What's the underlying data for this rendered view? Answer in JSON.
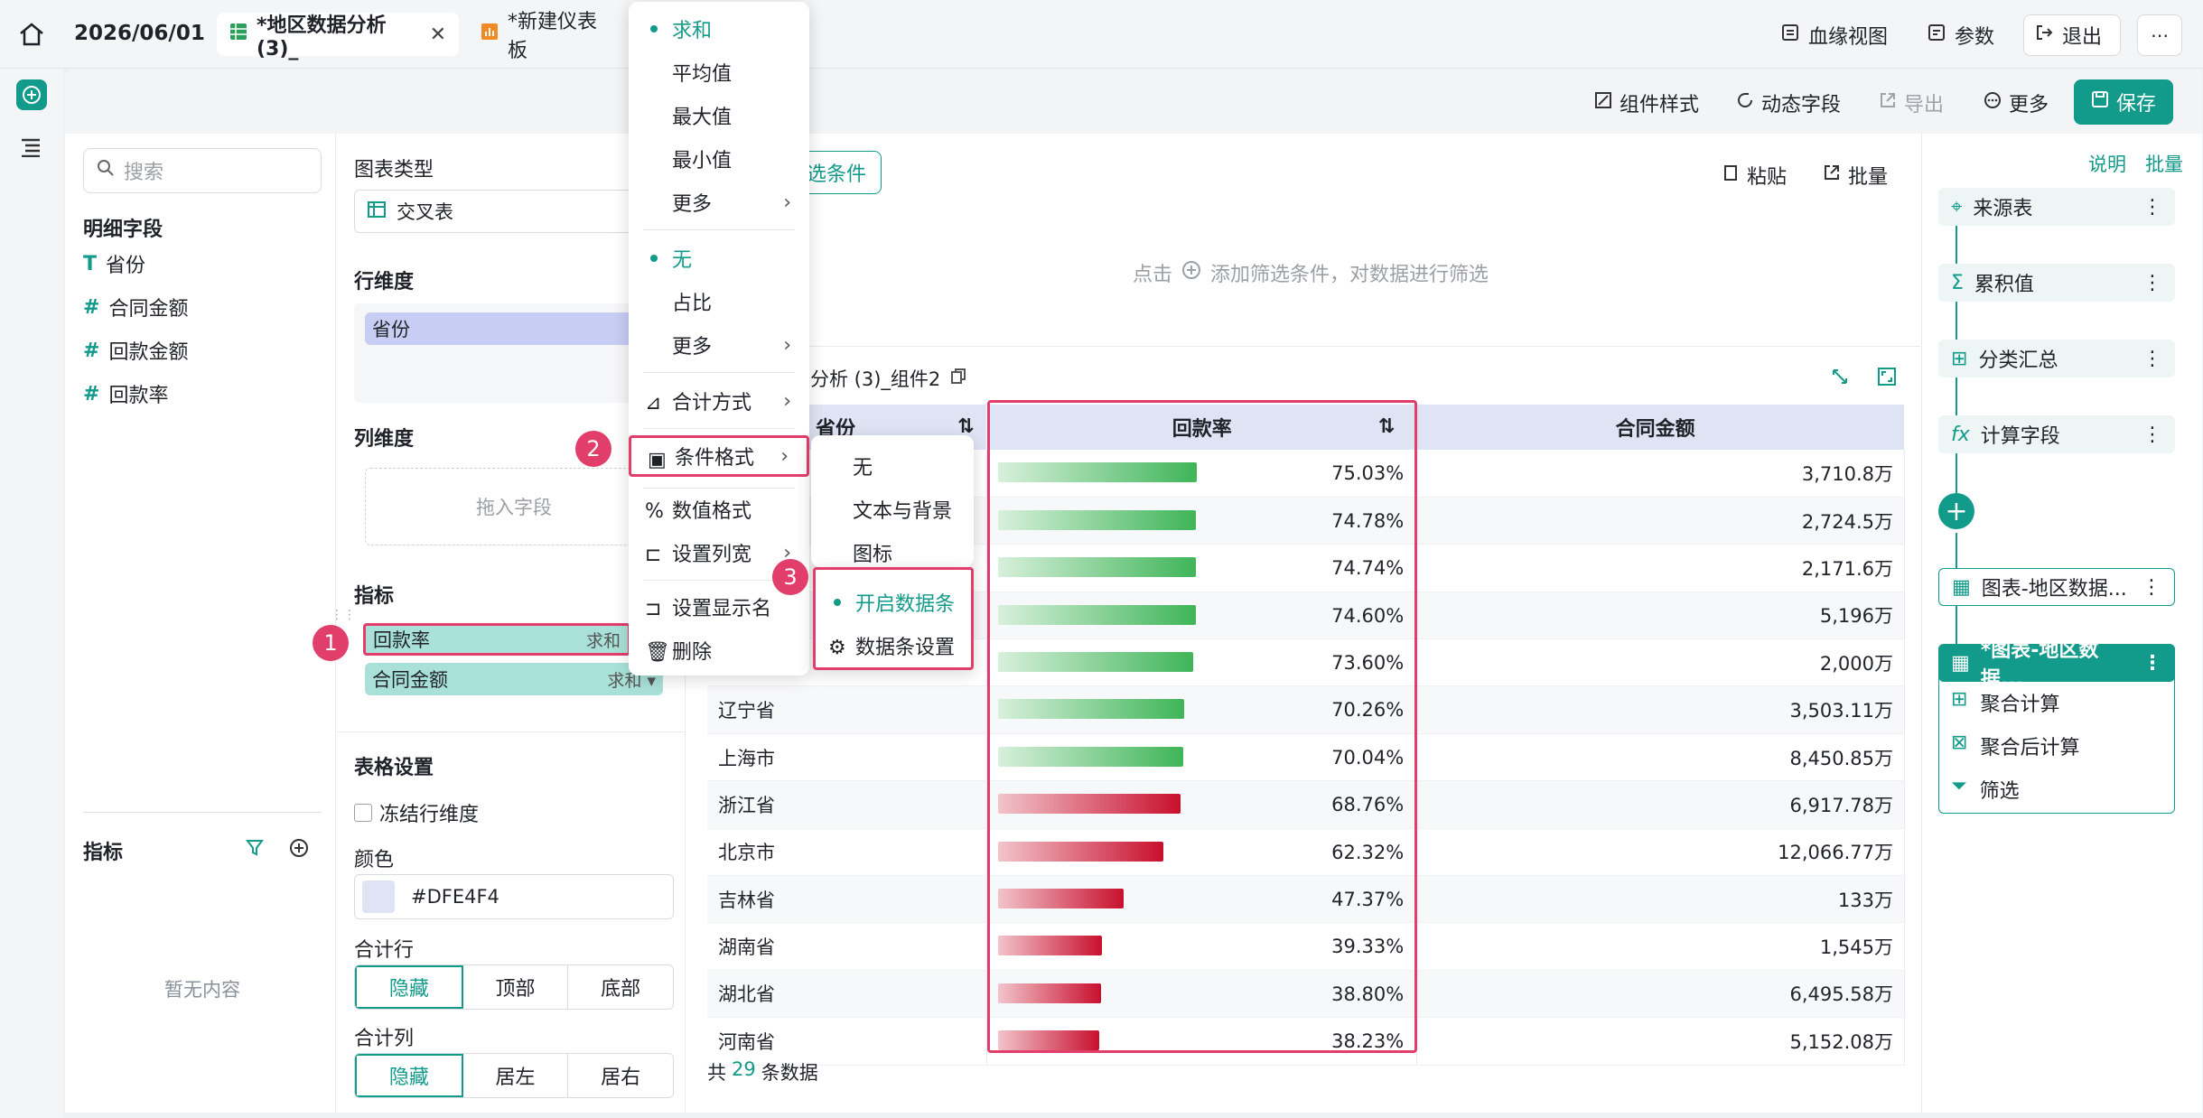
{
  "topbar": {
    "date": "2026/06/01",
    "tabs": [
      {
        "label": "*地区数据分析 (3)_",
        "active": true
      },
      {
        "label": "*新建仪表板",
        "active": false
      }
    ],
    "lineage_label": "血缘视图",
    "params_label": "参数",
    "exit_label": "退出"
  },
  "toolbar": {
    "component_style": "组件样式",
    "dynamic_field": "动态字段",
    "export": "导出",
    "more": "更多",
    "save": "保存"
  },
  "field_panel": {
    "search_placeholder": "搜索",
    "detail_fields_title": "明细字段",
    "fields": [
      "省份",
      "合同金额",
      "回款金额",
      "回款率"
    ],
    "metrics_title": "指标",
    "empty_text": "暂无内容"
  },
  "config": {
    "chart_type_label": "图表类型",
    "chart_type_value": "交叉表",
    "row_dim_label": "行维度",
    "row_dim_field": "省份",
    "col_dim_label": "列维度",
    "drag_hint": "拖入字段",
    "metrics_label": "指标",
    "metric_1": "回款率",
    "metric_1_agg": "求和",
    "metric_2": "合同金额",
    "metric_2_agg": "求和",
    "table_settings": "表格设置",
    "freeze_row_dim": "冻结行维度",
    "color_label": "颜色",
    "color_value": "#DFE4F4",
    "total_row_label": "合计行",
    "total_row_options": [
      "隐藏",
      "顶部",
      "底部"
    ],
    "total_col_label": "合计列",
    "total_col_options": [
      "隐藏",
      "居左",
      "居右"
    ]
  },
  "filter": {
    "add_condition": "选条件",
    "paste": "粘贴",
    "batch": "批量",
    "hint_prefix": "点击",
    "hint_text": "添加筛选条件，对数据进行筛选"
  },
  "table": {
    "component_title": "据分析 (3)_组件2",
    "headers": [
      "省份",
      "回款率",
      "合同金额"
    ],
    "rows": [
      {
        "province": "",
        "rate": "75.03%",
        "rate_num": 75.03,
        "amount": "3,710.8万",
        "color": "green"
      },
      {
        "province": "",
        "rate": "74.78%",
        "rate_num": 74.78,
        "amount": "2,724.5万",
        "color": "green"
      },
      {
        "province": "",
        "rate": "74.74%",
        "rate_num": 74.74,
        "amount": "2,171.6万",
        "color": "green"
      },
      {
        "province": "",
        "rate": "74.60%",
        "rate_num": 74.6,
        "amount": "5,196万",
        "color": "green"
      },
      {
        "province": "",
        "rate": "73.60%",
        "rate_num": 73.6,
        "amount": "2,000万",
        "color": "green"
      },
      {
        "province": "辽宁省",
        "rate": "70.26%",
        "rate_num": 70.26,
        "amount": "3,503.11万",
        "color": "green"
      },
      {
        "province": "上海市",
        "rate": "70.04%",
        "rate_num": 70.04,
        "amount": "8,450.85万",
        "color": "green"
      },
      {
        "province": "浙江省",
        "rate": "68.76%",
        "rate_num": 68.76,
        "amount": "6,917.78万",
        "color": "red"
      },
      {
        "province": "北京市",
        "rate": "62.32%",
        "rate_num": 62.32,
        "amount": "12,066.77万",
        "color": "red"
      },
      {
        "province": "吉林省",
        "rate": "47.37%",
        "rate_num": 47.37,
        "amount": "133万",
        "color": "red"
      },
      {
        "province": "湖南省",
        "rate": "39.33%",
        "rate_num": 39.33,
        "amount": "1,545万",
        "color": "red"
      },
      {
        "province": "湖北省",
        "rate": "38.80%",
        "rate_num": 38.8,
        "amount": "6,495.58万",
        "color": "red"
      },
      {
        "province": "河南省",
        "rate": "38.23%",
        "rate_num": 38.23,
        "amount": "5,152.08万",
        "color": "red"
      }
    ],
    "footer_prefix": "共",
    "footer_count": "29",
    "footer_suffix": "条数据"
  },
  "right_panel": {
    "explain": "说明",
    "batch": "批量",
    "nodes": [
      "来源表",
      "累积值",
      "分类汇总",
      "计算字段"
    ],
    "chart_node_1": "图表-地区数据...",
    "chart_node_2": "*图表-地区数据...",
    "sub_items": [
      "聚合计算",
      "聚合后计算",
      "筛选"
    ]
  },
  "menu": {
    "agg": [
      "求和",
      "平均值",
      "最大值",
      "最小值",
      "更多"
    ],
    "ratio": [
      "无",
      "占比",
      "更多"
    ],
    "total_method": "合计方式",
    "cond_format": "条件格式",
    "number_format": "数值格式",
    "col_width": "设置列宽",
    "display_name": "设置显示名",
    "delete": "删除"
  },
  "submenu_cf": [
    "无",
    "文本与背景",
    "图标"
  ],
  "submenu_bar": [
    "开启数据条",
    "数据条设置"
  ],
  "badges": [
    "1",
    "2",
    "3"
  ],
  "colors": {
    "accent": "#129a8a",
    "highlight": "#e23e6b",
    "header_bg": "#DFE4F4"
  }
}
